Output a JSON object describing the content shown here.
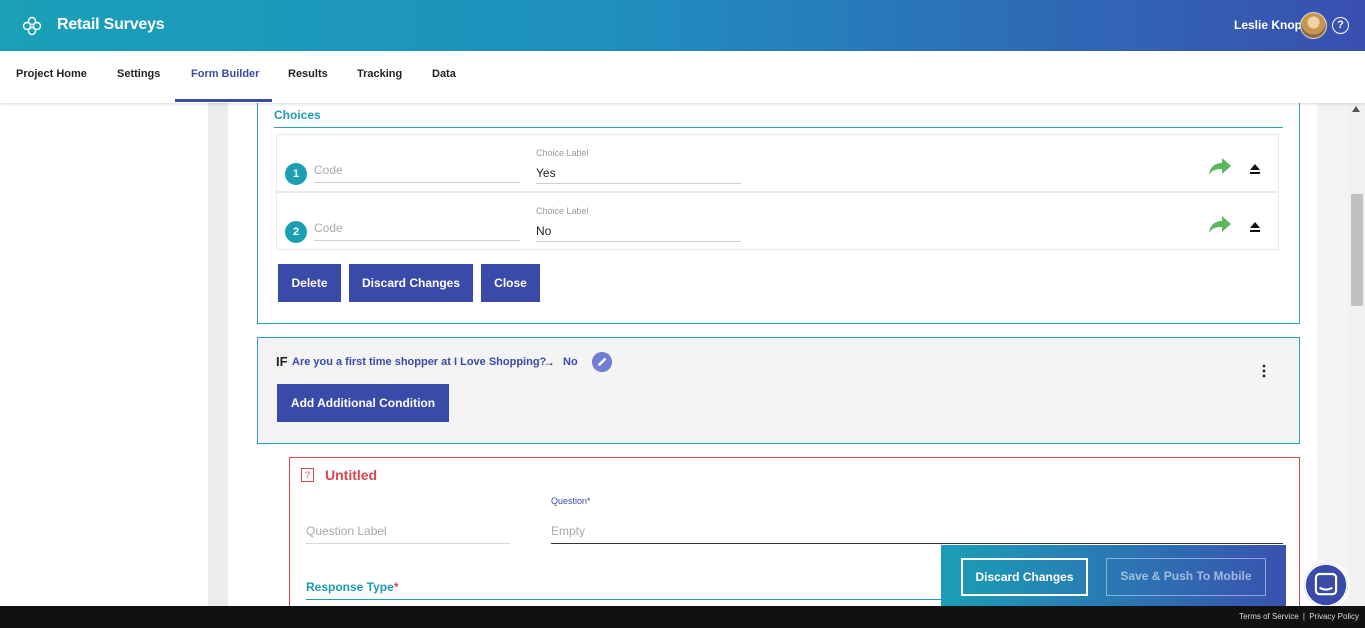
{
  "header": {
    "app_title": "Retail Surveys",
    "user_name": "Leslie Knope",
    "help_glyph": "?"
  },
  "tabs": [
    {
      "label": "Project Home"
    },
    {
      "label": "Settings"
    },
    {
      "label": "Form Builder",
      "active": true
    },
    {
      "label": "Results"
    },
    {
      "label": "Tracking"
    },
    {
      "label": "Data"
    }
  ],
  "choices": {
    "title": "Choices",
    "items": [
      {
        "number": "1",
        "code_placeholder": "Code",
        "label_caption": "Choice Label",
        "label_value": "Yes"
      },
      {
        "number": "2",
        "code_placeholder": "Code",
        "label_caption": "Choice Label",
        "label_value": "No"
      }
    ],
    "buttons": {
      "delete": "Delete",
      "discard": "Discard Changes",
      "close": "Close"
    }
  },
  "condition": {
    "if_label": "IF",
    "question": "Are you a first time shopper at I Love Shopping?",
    "arrow": "→",
    "answer": "No",
    "add_button": "Add Additional Condition"
  },
  "question_card": {
    "icon_glyph": "?",
    "title": "Untitled",
    "question_caption": "Question*",
    "label_placeholder": "Question Label",
    "question_placeholder": "Empty",
    "response_type_label": "Response Type",
    "required_mark": "*"
  },
  "action_bar": {
    "discard": "Discard Changes",
    "push": "Save & Push To Mobile"
  },
  "footer": {
    "terms": "Terms of Service",
    "separator": "|",
    "privacy": "Privacy Policy"
  },
  "colors": {
    "accent": "#3a4aa8",
    "teal": "#1aa0b0",
    "error": "#d8474e",
    "share_green": "#5cb85c"
  }
}
